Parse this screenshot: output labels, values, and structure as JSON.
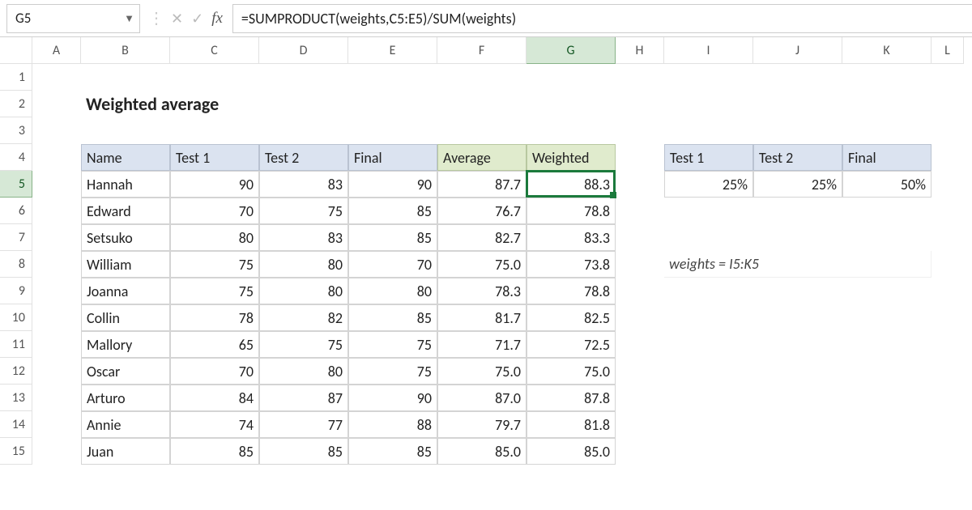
{
  "nameBox": "G5",
  "formula": "=SUMPRODUCT(weights,C5:E5)/SUM(weights)",
  "title": "Weighted average",
  "columns": [
    "A",
    "B",
    "C",
    "D",
    "E",
    "F",
    "G",
    "H",
    "I",
    "J",
    "K",
    "L"
  ],
  "rows": [
    "1",
    "2",
    "3",
    "4",
    "5",
    "6",
    "7",
    "8",
    "9",
    "10",
    "11",
    "12",
    "13",
    "14",
    "15"
  ],
  "selectedCol": "G",
  "selectedRow": "5",
  "mainHeaders": [
    "Name",
    "Test 1",
    "Test 2",
    "Final",
    "Average",
    "Weighted"
  ],
  "mainRows": [
    {
      "name": "Hannah",
      "t1": "90",
      "t2": "83",
      "fin": "90",
      "avg": "87.7",
      "w": "88.3"
    },
    {
      "name": "Edward",
      "t1": "70",
      "t2": "75",
      "fin": "85",
      "avg": "76.7",
      "w": "78.8"
    },
    {
      "name": "Setsuko",
      "t1": "80",
      "t2": "83",
      "fin": "85",
      "avg": "82.7",
      "w": "83.3"
    },
    {
      "name": "William",
      "t1": "75",
      "t2": "80",
      "fin": "70",
      "avg": "75.0",
      "w": "73.8"
    },
    {
      "name": "Joanna",
      "t1": "75",
      "t2": "80",
      "fin": "80",
      "avg": "78.3",
      "w": "78.8"
    },
    {
      "name": "Collin",
      "t1": "78",
      "t2": "82",
      "fin": "85",
      "avg": "81.7",
      "w": "82.5"
    },
    {
      "name": "Mallory",
      "t1": "65",
      "t2": "75",
      "fin": "75",
      "avg": "71.7",
      "w": "72.5"
    },
    {
      "name": "Oscar",
      "t1": "70",
      "t2": "80",
      "fin": "75",
      "avg": "75.0",
      "w": "75.0"
    },
    {
      "name": "Arturo",
      "t1": "84",
      "t2": "87",
      "fin": "90",
      "avg": "87.0",
      "w": "87.8"
    },
    {
      "name": "Annie",
      "t1": "74",
      "t2": "77",
      "fin": "88",
      "avg": "79.7",
      "w": "81.8"
    },
    {
      "name": "Juan",
      "t1": "85",
      "t2": "85",
      "fin": "85",
      "avg": "85.0",
      "w": "85.0"
    }
  ],
  "weightsHeaders": [
    "Test 1",
    "Test 2",
    "Final"
  ],
  "weightsValues": [
    "25%",
    "25%",
    "50%"
  ],
  "note": "weights = I5:K5",
  "chart_data": {
    "type": "table",
    "title": "Weighted average",
    "main": {
      "columns": [
        "Name",
        "Test 1",
        "Test 2",
        "Final",
        "Average",
        "Weighted"
      ],
      "rows": [
        [
          "Hannah",
          90,
          83,
          90,
          87.7,
          88.3
        ],
        [
          "Edward",
          70,
          75,
          85,
          76.7,
          78.8
        ],
        [
          "Setsuko",
          80,
          83,
          85,
          82.7,
          83.3
        ],
        [
          "William",
          75,
          80,
          70,
          75.0,
          73.8
        ],
        [
          "Joanna",
          75,
          80,
          80,
          78.3,
          78.8
        ],
        [
          "Collin",
          78,
          82,
          85,
          81.7,
          82.5
        ],
        [
          "Mallory",
          65,
          75,
          75,
          71.7,
          72.5
        ],
        [
          "Oscar",
          70,
          80,
          75,
          75.0,
          75.0
        ],
        [
          "Arturo",
          84,
          87,
          90,
          87.0,
          87.8
        ],
        [
          "Annie",
          74,
          77,
          88,
          79.7,
          81.8
        ],
        [
          "Juan",
          85,
          85,
          85,
          85.0,
          85.0
        ]
      ]
    },
    "weights": {
      "Test 1": 0.25,
      "Test 2": 0.25,
      "Final": 0.5
    },
    "formula": "=SUMPRODUCT(weights,C5:E5)/SUM(weights)"
  }
}
